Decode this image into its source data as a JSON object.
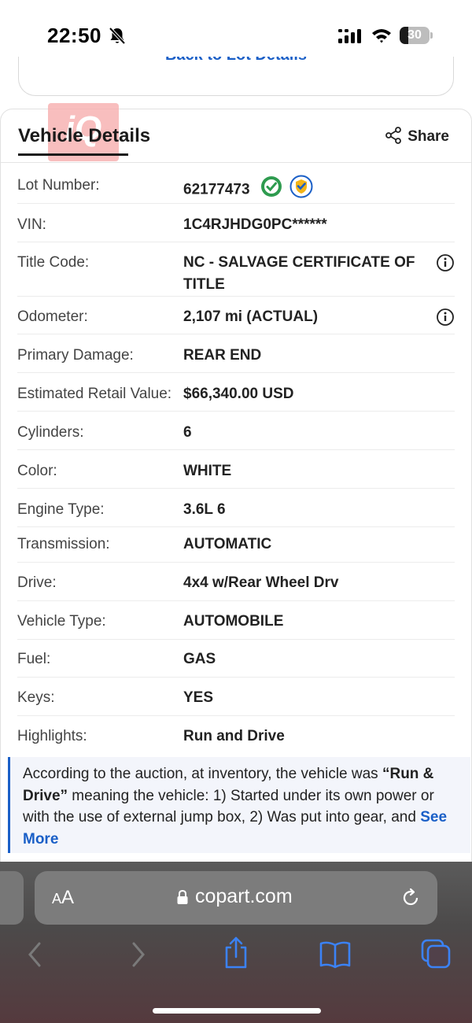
{
  "status_bar": {
    "time": "22:50",
    "battery_level": "30",
    "battery_percent": 30
  },
  "back_link": {
    "label": "Back to Lot Details"
  },
  "watermark": {
    "text": "iQ"
  },
  "vehicle_details": {
    "title": "Vehicle Details",
    "share_label": "Share",
    "rows": [
      {
        "label": "Lot Number:",
        "value": "62177473"
      },
      {
        "label": "VIN:",
        "value": "1C4RJHDG0PC******"
      },
      {
        "label": "Title Code:",
        "value": "NC - SALVAGE CERTIFICATE OF TITLE"
      },
      {
        "label": "Odometer:",
        "value": "2,107 mi (ACTUAL)"
      },
      {
        "label": "Primary Damage:",
        "value": "REAR END"
      },
      {
        "label": "Estimated Retail Value:",
        "value": "$66,340.00 USD"
      },
      {
        "label": "Cylinders:",
        "value": "6"
      },
      {
        "label": "Color:",
        "value": "WHITE"
      },
      {
        "label": "Engine Type:",
        "value": "3.6L 6"
      },
      {
        "label": "Transmission:",
        "value": "AUTOMATIC"
      },
      {
        "label": "Drive:",
        "value": "4x4 w/Rear Wheel Drv"
      },
      {
        "label": "Vehicle Type:",
        "value": "AUTOMOBILE"
      },
      {
        "label": "Fuel:",
        "value": "GAS"
      },
      {
        "label": "Keys:",
        "value": "YES"
      },
      {
        "label": "Highlights:",
        "value": "Run and Drive"
      }
    ]
  },
  "highlight_note": {
    "prefix": "According to the auction, at inventory, the vehicle was ",
    "emphasis": "“Run & Drive”",
    "suffix": " meaning the vehicle: 1) Started under its own power or with the use of external jump box, 2) Was put into gear, and ",
    "see_more": "See More"
  },
  "browser": {
    "aa_small": "A",
    "aa_large": "A",
    "url": "copart.com"
  },
  "colors": {
    "accent": "#1a5fc7",
    "badge_green": "#2e9b4f",
    "badge_blue": "#1a5fc7",
    "badge_gold": "#f2b418"
  }
}
